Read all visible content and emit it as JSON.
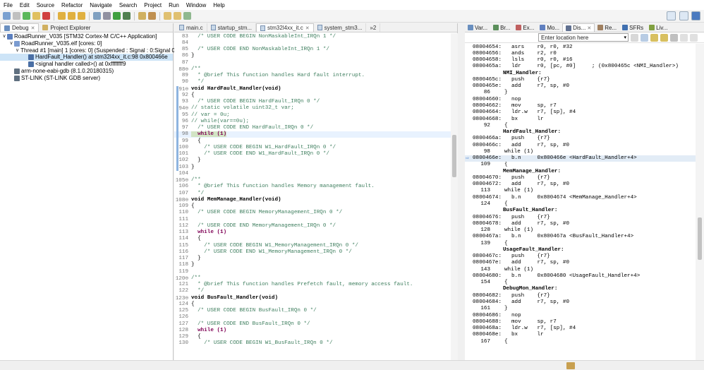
{
  "menu": [
    "File",
    "Edit",
    "Source",
    "Refactor",
    "Navigate",
    "Search",
    "Project",
    "Run",
    "Window",
    "Help"
  ],
  "left": {
    "tabs": [
      {
        "label": "Debug",
        "close": "✕"
      },
      {
        "label": "Project Explorer",
        "close": ""
      }
    ],
    "tree": [
      {
        "indent": 0,
        "twisty": "∨",
        "icon": "c-app-icon",
        "text": "RoadRunner_V035 [STM32 Cortex-M C/C++ Application]",
        "sel": false
      },
      {
        "indent": 1,
        "twisty": "∨",
        "icon": "elf-icon",
        "text": "RoadRunner_V035.elf [cores: 0]",
        "sel": false
      },
      {
        "indent": 2,
        "twisty": "∨",
        "icon": "thread-icon",
        "text": "Thread #1 [main] 1 [cores: 0] (Suspended : Signal : 0:Signal 0)",
        "sel": false
      },
      {
        "indent": 3,
        "twisty": "",
        "icon": "stack-frame-icon",
        "text": "HardFault_Handler() at stm32l4xx_it.c:98 0x800466e",
        "sel": true
      },
      {
        "indent": 3,
        "twisty": "",
        "icon": "stack-frame-icon",
        "text": "<signal handler called>() at 0xffffffff9",
        "sel": false
      },
      {
        "indent": 1,
        "twisty": "",
        "icon": "gdb-icon",
        "text": "arm-none-eabi-gdb (8.1.0.20180315)",
        "sel": false
      },
      {
        "indent": 1,
        "twisty": "",
        "icon": "stlink-icon",
        "text": "ST-LINK (ST-LINK GDB server)",
        "sel": false
      }
    ]
  },
  "editor": {
    "tabs": [
      {
        "label": "main.c",
        "active": false
      },
      {
        "label": "startup_stm...",
        "active": false
      },
      {
        "label": "stm32l4xx_it.c",
        "active": true
      },
      {
        "label": "system_stm3...",
        "active": false
      }
    ],
    "overflow": "»2",
    "lines": [
      {
        "n": "83",
        "t": "  /* USER CODE BEGIN NonMaskableInt_IRQn 1 */",
        "c": "cmt"
      },
      {
        "n": "84",
        "t": "",
        "c": ""
      },
      {
        "n": "85",
        "t": "  /* USER CODE END NonMaskableInt_IRQn 1 */",
        "c": "cmt"
      },
      {
        "n": "86",
        "t": "}",
        "c": ""
      },
      {
        "n": "87",
        "t": "",
        "c": ""
      },
      {
        "n": "88⊖",
        "t": "/**",
        "c": "cmt"
      },
      {
        "n": "89",
        "t": "  * @brief This function handles Hard fault interrupt.",
        "c": "cmt"
      },
      {
        "n": "90",
        "t": "  */",
        "c": "cmt"
      },
      {
        "n": "91⊖",
        "t": "void HardFault_Handler(void)",
        "c": "fn"
      },
      {
        "n": "92",
        "t": "{",
        "c": ""
      },
      {
        "n": "93",
        "t": "  /* USER CODE BEGIN HardFault_IRQn 0 */",
        "c": "cmt"
      },
      {
        "n": "94⊖",
        "t": "// static volatile uint32_t var;",
        "c": "cmt"
      },
      {
        "n": "95",
        "t": "// var = 0u;",
        "c": "cmt"
      },
      {
        "n": "96",
        "t": "// while(var==0u);",
        "c": "cmt"
      },
      {
        "n": "97",
        "t": "  /* USER CODE END HardFault_IRQn 0 */",
        "c": "cmt"
      },
      {
        "n": "98",
        "t": "  while (1)",
        "c": "hl"
      },
      {
        "n": "99",
        "t": "  {",
        "c": ""
      },
      {
        "n": "100",
        "t": "    /* USER CODE BEGIN W1_HardFault_IRQn 0 */",
        "c": "cmt"
      },
      {
        "n": "101",
        "t": "    /* USER CODE END W1_HardFault_IRQn 0 */",
        "c": "cmt"
      },
      {
        "n": "102",
        "t": "  }",
        "c": ""
      },
      {
        "n": "103",
        "t": "}",
        "c": ""
      },
      {
        "n": "104",
        "t": "",
        "c": ""
      },
      {
        "n": "105⊖",
        "t": "/**",
        "c": "cmt"
      },
      {
        "n": "106",
        "t": "  * @brief This function handles Memory management fault.",
        "c": "cmt"
      },
      {
        "n": "107",
        "t": "  */",
        "c": "cmt"
      },
      {
        "n": "108⊖",
        "t": "void MemManage_Handler(void)",
        "c": "fn"
      },
      {
        "n": "109",
        "t": "{",
        "c": ""
      },
      {
        "n": "110",
        "t": "  /* USER CODE BEGIN MemoryManagement_IRQn 0 */",
        "c": "cmt"
      },
      {
        "n": "111",
        "t": "",
        "c": ""
      },
      {
        "n": "112",
        "t": "  /* USER CODE END MemoryManagement_IRQn 0 */",
        "c": "cmt"
      },
      {
        "n": "113",
        "t": "  while (1)",
        "c": "wh"
      },
      {
        "n": "114",
        "t": "  {",
        "c": ""
      },
      {
        "n": "115",
        "t": "    /* USER CODE BEGIN W1_MemoryManagement_IRQn 0 */",
        "c": "cmt"
      },
      {
        "n": "116",
        "t": "    /* USER CODE END W1_MemoryManagement_IRQn 0 */",
        "c": "cmt"
      },
      {
        "n": "117",
        "t": "  }",
        "c": ""
      },
      {
        "n": "118",
        "t": "}",
        "c": ""
      },
      {
        "n": "119",
        "t": "",
        "c": ""
      },
      {
        "n": "120⊖",
        "t": "/**",
        "c": "cmt"
      },
      {
        "n": "121",
        "t": "  * @brief This function handles Prefetch fault, memory access fault.",
        "c": "cmt"
      },
      {
        "n": "122",
        "t": "  */",
        "c": "cmt"
      },
      {
        "n": "123⊖",
        "t": "void BusFault_Handler(void)",
        "c": "fn"
      },
      {
        "n": "124",
        "t": "{",
        "c": ""
      },
      {
        "n": "125",
        "t": "  /* USER CODE BEGIN BusFault_IRQn 0 */",
        "c": "cmt"
      },
      {
        "n": "126",
        "t": "",
        "c": ""
      },
      {
        "n": "127",
        "t": "  /* USER CODE END BusFault_IRQn 0 */",
        "c": "cmt"
      },
      {
        "n": "128",
        "t": "  while (1)",
        "c": "wh"
      },
      {
        "n": "129",
        "t": "  {",
        "c": ""
      },
      {
        "n": "130",
        "t": "    /* USER CODE BEGIN W1_BusFault_IRQn 0 */",
        "c": "cmt"
      }
    ]
  },
  "dis": {
    "tabs": [
      {
        "label": "Var...",
        "active": false
      },
      {
        "label": "Br...",
        "active": false
      },
      {
        "label": "Ex...",
        "active": false
      },
      {
        "label": "Mo...",
        "active": false
      },
      {
        "label": "Dis...",
        "active": true
      },
      {
        "label": "Re...",
        "active": false
      },
      {
        "label": "SFRs",
        "active": false
      },
      {
        "label": "Liv...",
        "active": false
      }
    ],
    "location_placeholder": "Enter location here",
    "lines": [
      {
        "k": "i",
        "a": "08004654:",
        "t": "asrs    r0, r0, #32"
      },
      {
        "k": "i",
        "a": "08004656:",
        "t": "ands    r2, r0"
      },
      {
        "k": "i",
        "a": "08004658:",
        "t": "lsls    r0, r0, #16"
      },
      {
        "k": "i",
        "a": "0800465a:",
        "t": "ldr     r0, [pc, #0]     ; (0x800465c <NMI_Handler>)"
      },
      {
        "k": "l",
        "a": "",
        "t": "NMI_Handler:"
      },
      {
        "k": "i",
        "a": "0800465c:",
        "t": "push    {r7}"
      },
      {
        "k": "i",
        "a": "0800465e:",
        "t": "add     r7, sp, #0"
      },
      {
        "k": "s",
        "a": "86",
        "t": "}"
      },
      {
        "k": "i",
        "a": "08004660:",
        "t": "nop"
      },
      {
        "k": "i",
        "a": "08004662:",
        "t": "mov     sp, r7"
      },
      {
        "k": "i",
        "a": "08004664:",
        "t": "ldr.w   r7, [sp], #4"
      },
      {
        "k": "i",
        "a": "08004668:",
        "t": "bx      lr"
      },
      {
        "k": "s",
        "a": "92",
        "t": "{"
      },
      {
        "k": "l",
        "a": "",
        "t": "HardFault_Handler:"
      },
      {
        "k": "i",
        "a": "0800466a:",
        "t": "push    {r7}"
      },
      {
        "k": "i",
        "a": "0800466c:",
        "t": "add     r7, sp, #0"
      },
      {
        "k": "s",
        "a": "98",
        "t": "while (1)"
      },
      {
        "k": "c",
        "a": "0800466e:",
        "t": "b.n     0x800466e <HardFault_Handler+4>"
      },
      {
        "k": "s",
        "a": "109",
        "t": "{"
      },
      {
        "k": "l",
        "a": "",
        "t": "MemManage_Handler:"
      },
      {
        "k": "i",
        "a": "08004670:",
        "t": "push    {r7}"
      },
      {
        "k": "i",
        "a": "08004672:",
        "t": "add     r7, sp, #0"
      },
      {
        "k": "s",
        "a": "113",
        "t": "while (1)"
      },
      {
        "k": "i",
        "a": "08004674:",
        "t": "b.n     0x8004674 <MemManage_Handler+4>"
      },
      {
        "k": "s",
        "a": "124",
        "t": "{"
      },
      {
        "k": "l",
        "a": "",
        "t": "BusFault_Handler:"
      },
      {
        "k": "i",
        "a": "08004676:",
        "t": "push    {r7}"
      },
      {
        "k": "i",
        "a": "08004678:",
        "t": "add     r7, sp, #0"
      },
      {
        "k": "s",
        "a": "128",
        "t": "while (1)"
      },
      {
        "k": "i",
        "a": "0800467a:",
        "t": "b.n     0x800467a <BusFault_Handler+4>"
      },
      {
        "k": "s",
        "a": "139",
        "t": "{"
      },
      {
        "k": "l",
        "a": "",
        "t": "UsageFault_Handler:"
      },
      {
        "k": "i",
        "a": "0800467c:",
        "t": "push    {r7}"
      },
      {
        "k": "i",
        "a": "0800467e:",
        "t": "add     r7, sp, #0"
      },
      {
        "k": "s",
        "a": "143",
        "t": "while (1)"
      },
      {
        "k": "i",
        "a": "08004680:",
        "t": "b.n     0x8004680 <UsageFault_Handler+4>"
      },
      {
        "k": "s",
        "a": "154",
        "t": "{"
      },
      {
        "k": "l",
        "a": "",
        "t": "DebugMon_Handler:"
      },
      {
        "k": "i",
        "a": "08004682:",
        "t": "push    {r7}"
      },
      {
        "k": "i",
        "a": "08004684:",
        "t": "add     r7, sp, #0"
      },
      {
        "k": "s",
        "a": "161",
        "t": "}"
      },
      {
        "k": "i",
        "a": "08004686:",
        "t": "nop"
      },
      {
        "k": "i",
        "a": "08004688:",
        "t": "mov     sp, r7"
      },
      {
        "k": "i",
        "a": "0800468a:",
        "t": "ldr.w   r7, [sp], #4"
      },
      {
        "k": "i",
        "a": "0800468e:",
        "t": "bx      lr"
      },
      {
        "k": "s",
        "a": "167",
        "t": "{"
      }
    ]
  },
  "colors": {
    "accent": "#3874c8",
    "selection": "#cde4f7",
    "comment": "#3f7f5f",
    "keyword": "#7f0055"
  }
}
